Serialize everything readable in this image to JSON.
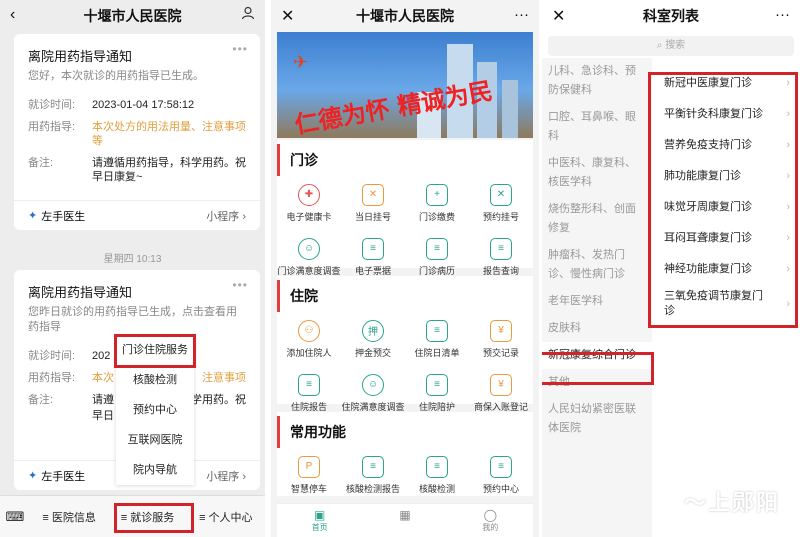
{
  "panel1": {
    "title": "十堰市人民医院",
    "back": "‹",
    "card1": {
      "title": "离院用药指导通知",
      "sub": "您好，本次就诊的用药指导已生成。",
      "rows": [
        {
          "k": "就诊时间:",
          "v": "2023-01-04 17:58:12"
        },
        {
          "k": "用药指导:",
          "v": "本次处方的用法用量、注意事项等"
        },
        {
          "k": "备注:",
          "v": "请遵循用药指导，科学用药。祝早日康复~"
        }
      ],
      "footer_left": "左手医生",
      "footer_right": "小程序 ›"
    },
    "day_label": "星期四 10:13",
    "card2": {
      "title": "离院用药指导通知",
      "sub": "您昨日就诊的用药指导已生成，点击查看用药指导",
      "rows": [
        {
          "k": "就诊时间:",
          "v": "202"
        },
        {
          "k": "用药指导:",
          "v": "本次"
        },
        {
          "k": "备注:",
          "v": "请遵"
        }
      ],
      "row2_tail": "注意事项",
      "row3_tail": "学用药。祝",
      "row3_line2": "早日",
      "footer_left": "左手医生",
      "footer_right": "小程序 ›"
    },
    "popup": [
      "门诊住院服务",
      "核酸检测",
      "预约中心",
      "互联网医院",
      "院内导航"
    ],
    "bottom_tabs": [
      "医院信息",
      "就诊服务",
      "个人中心"
    ]
  },
  "panel2": {
    "title": "十堰市人民医院",
    "close": "✕",
    "more": "···",
    "banner_slogan": "仁德为怀 精诚为民",
    "sections": [
      {
        "title": "门诊",
        "items": [
          "电子健康卡",
          "当日挂号",
          "门诊缴费",
          "预约挂号",
          "门诊满意度调查",
          "电子票据",
          "门诊病历",
          "报告查询"
        ]
      },
      {
        "title": "住院",
        "items": [
          "添加住院人",
          "押金预交",
          "住院日清单",
          "预交记录",
          "住院报告",
          "住院满意度调查",
          "住院陪护",
          "商保入账登记"
        ]
      },
      {
        "title": "常用功能",
        "items": [
          "智慧停车",
          "核酸检测报告",
          "核酸检测",
          "预约中心"
        ]
      }
    ],
    "nav": [
      "首页",
      "",
      "我的"
    ]
  },
  "panel3": {
    "title": "科室列表",
    "close": "✕",
    "more": "···",
    "search_placeholder": "搜索",
    "depts": [
      "儿科、急诊科、预防保健科",
      "口腔、耳鼻喉、眼科",
      "中医科、康复科、核医学科",
      "烧伤整形科、创面修复",
      "肿瘤科、发热门诊、慢性病门诊",
      "老年医学科",
      "皮肤科",
      "新冠康复综合门诊",
      "其他",
      "人民妇幼紧密医联体医院"
    ],
    "subs": [
      "新冠中医康复门诊",
      "平衡针灸科康复门诊",
      "营养免疫支持门诊",
      "肺功能康复门诊",
      "味觉牙周康复门诊",
      "耳闷耳聋康复门诊",
      "神经功能康复门诊",
      "三氧免疫调节康复门诊"
    ]
  },
  "watermark": "上郧阳",
  "colors": {
    "highlight": "#d2232a",
    "teal": "#2aa48c",
    "orange": "#e0a040"
  }
}
